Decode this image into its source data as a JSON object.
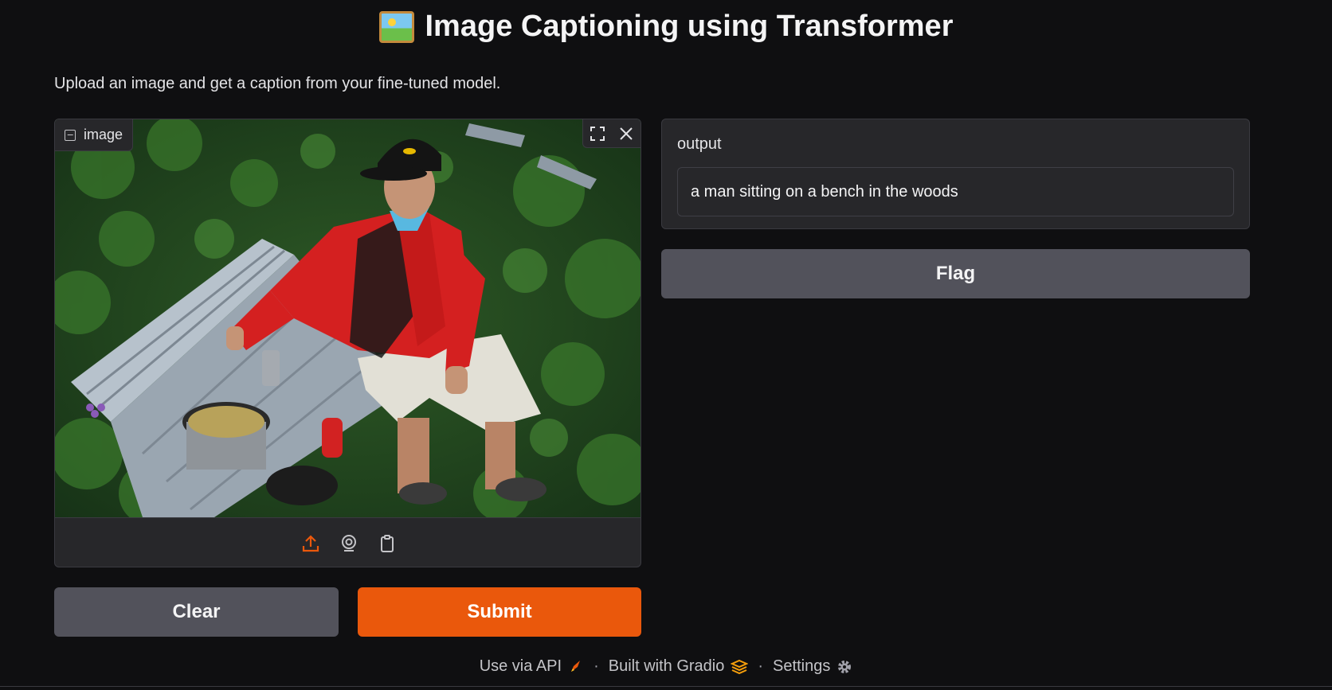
{
  "header": {
    "title": "Image Captioning using Transformer",
    "title_icon": "framed-picture-emoji",
    "description": "Upload an image and get a caption from your fine-tuned model."
  },
  "image_input": {
    "label": "image",
    "label_icon": "image-icon",
    "tools": [
      "fullscreen-icon",
      "close-icon"
    ],
    "sources": [
      "upload-icon",
      "webcam-icon",
      "clipboard-icon"
    ],
    "photo_subject": "man sitting on a bench in the woods"
  },
  "buttons": {
    "clear_label": "Clear",
    "submit_label": "Submit",
    "flag_label": "Flag"
  },
  "output": {
    "label": "output",
    "value": "a man sitting on a bench in the woods"
  },
  "footer": {
    "api_label": "Use via API",
    "built_label": "Built with Gradio",
    "settings_label": "Settings",
    "separator": "·"
  },
  "colors": {
    "background": "#0f0f11",
    "panel": "#27272a",
    "primary": "#ea580c",
    "secondary": "#52525b"
  }
}
